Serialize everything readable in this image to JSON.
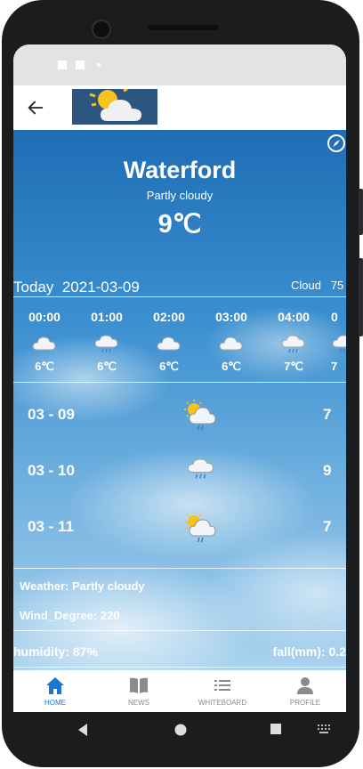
{
  "header": {
    "back_icon": "arrow-left-icon",
    "logo_icon": "sun-cloud-logo-icon"
  },
  "weather": {
    "city": "Waterford",
    "condition": "Partly cloudy",
    "temperature": "9℃",
    "location_icon": "compass-icon"
  },
  "today": {
    "label": "Today",
    "date": "2021-03-09",
    "cloud_label": "Cloud",
    "cloud_value": "75"
  },
  "hourly": [
    {
      "time": "00:00",
      "temp": "6℃",
      "icon": "cloud-icon"
    },
    {
      "time": "01:00",
      "temp": "6℃",
      "icon": "rain-cloud-icon"
    },
    {
      "time": "02:00",
      "temp": "6℃",
      "icon": "cloud-icon"
    },
    {
      "time": "03:00",
      "temp": "6℃",
      "icon": "cloud-icon"
    },
    {
      "time": "04:00",
      "temp": "7℃",
      "icon": "rain-cloud-icon"
    },
    {
      "time": "0",
      "temp": "7",
      "icon": "rain-cloud-icon"
    }
  ],
  "daily": [
    {
      "date": "03 - 09",
      "value": "7",
      "icon": "sun-rain-cloud-icon"
    },
    {
      "date": "03 - 10",
      "value": "9",
      "icon": "rain-cloud-icon"
    },
    {
      "date": "03 - 11",
      "value": "7",
      "icon": "sun-rain-cloud-icon"
    }
  ],
  "details": {
    "weather": "Weather: Partly cloudy",
    "wind": "Wind_Degree: 220",
    "humidity": "humidity: 87%",
    "fall": "fall(mm): 0.2"
  },
  "nav": [
    {
      "label": "HOME",
      "icon": "home-icon",
      "active": true
    },
    {
      "label": "NEWS",
      "icon": "book-icon",
      "active": false
    },
    {
      "label": "WHITEBOARD",
      "icon": "list-icon",
      "active": false
    },
    {
      "label": "PROFILE",
      "icon": "person-icon",
      "active": false
    }
  ],
  "colors": {
    "accent": "#1976d2",
    "sky_top": "#1f6db5",
    "sky_bottom": "#a9d2ee"
  }
}
